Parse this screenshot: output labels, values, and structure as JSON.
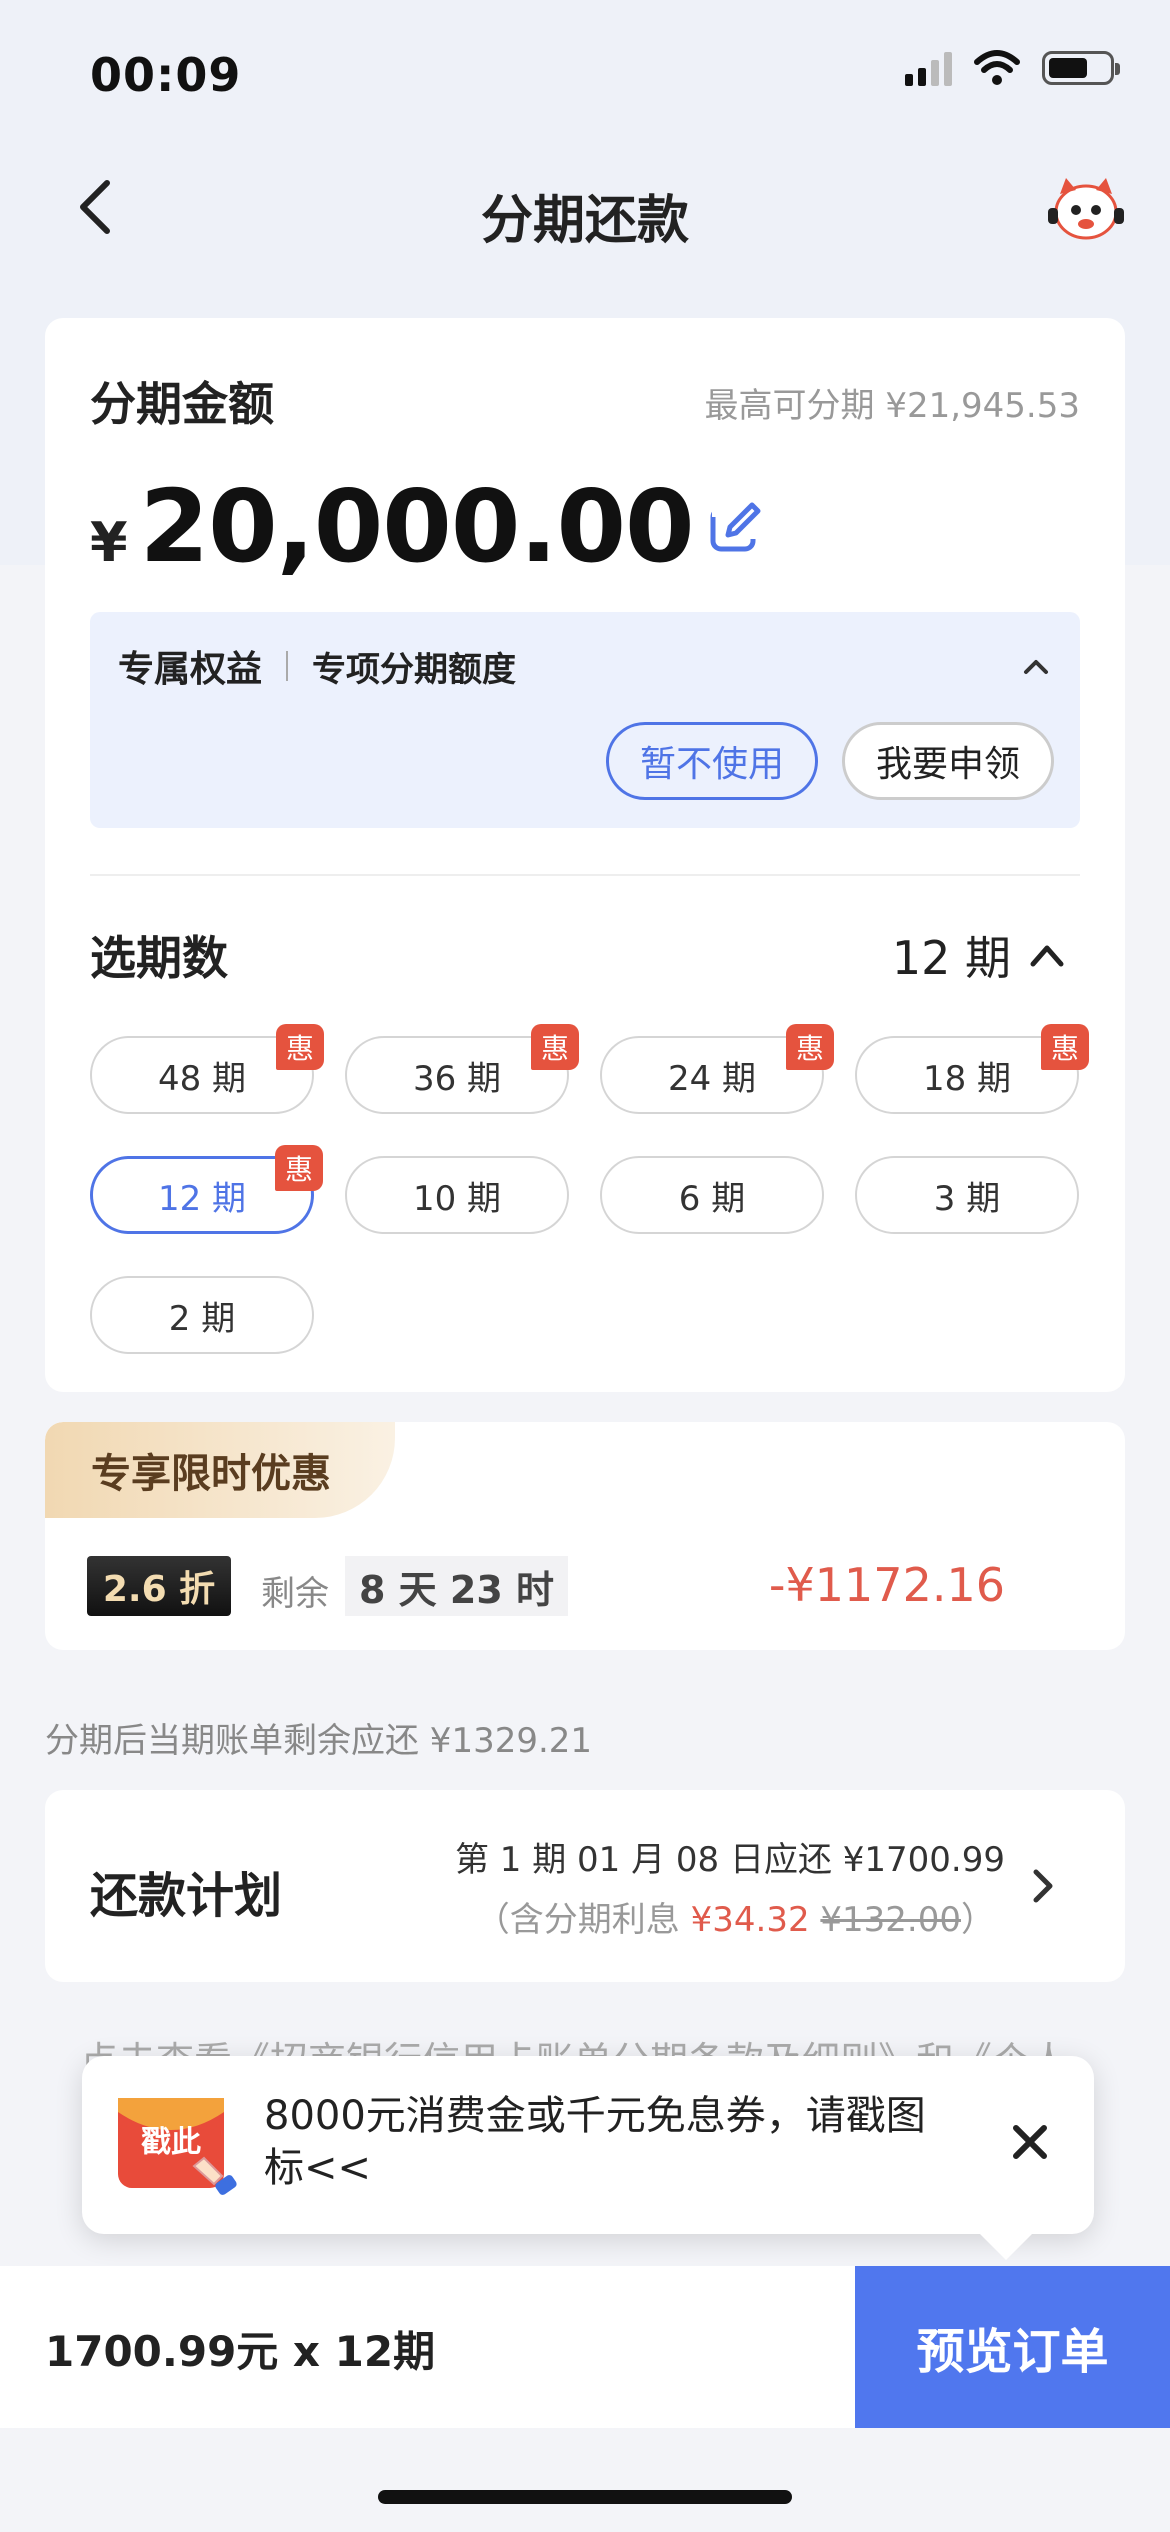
{
  "status": {
    "time": "00:09"
  },
  "nav": {
    "title": "分期还款"
  },
  "amount": {
    "label": "分期金额",
    "max_text": "最高可分期 ¥21,945.53",
    "currency": "¥",
    "value": "20,000.00"
  },
  "benefit": {
    "title": "专属权益",
    "subtitle": "专项分期额度",
    "decline_label": "暂不使用",
    "claim_label": "我要申领"
  },
  "periods": {
    "label": "选期数",
    "current": "12 期",
    "options": [
      {
        "label": "48 期",
        "badge": "惠"
      },
      {
        "label": "36 期",
        "badge": "惠"
      },
      {
        "label": "24 期",
        "badge": "惠"
      },
      {
        "label": "18 期",
        "badge": "惠"
      },
      {
        "label": "12 期",
        "badge": "惠"
      },
      {
        "label": "10 期",
        "badge": ""
      },
      {
        "label": "6 期",
        "badge": ""
      },
      {
        "label": "3 期",
        "badge": ""
      },
      {
        "label": "2 期",
        "badge": ""
      }
    ],
    "selected_index": 4
  },
  "promo": {
    "tag": "专享限时优惠",
    "discount": "2.6 折",
    "remain_label": "剩余",
    "remain_time": "8 天 23 时",
    "amount": "-¥1172.16"
  },
  "after_text": "分期后当期账单剩余应还 ¥1329.21",
  "plan": {
    "label": "还款计划",
    "line1": "第 1 期 01 月 08 日应还 ¥1700.99",
    "line2_prefix": "（含分期利息",
    "interest": "¥34.32",
    "original": "¥132.00",
    "line2_suffix": "）"
  },
  "terms_text": "点击查看《招商银行信用卡账单分期条款及细则》和《个人",
  "popup": {
    "icon_text": "戳此",
    "text": "8000元消费金或千元免息券，请戳图标<<"
  },
  "bottom": {
    "summary": "1700.99元 x 12期",
    "button_label": "预览订单"
  },
  "colors": {
    "accent": "#5077ee",
    "badge_red": "#e5533e",
    "discount_red": "#e05b4c"
  }
}
